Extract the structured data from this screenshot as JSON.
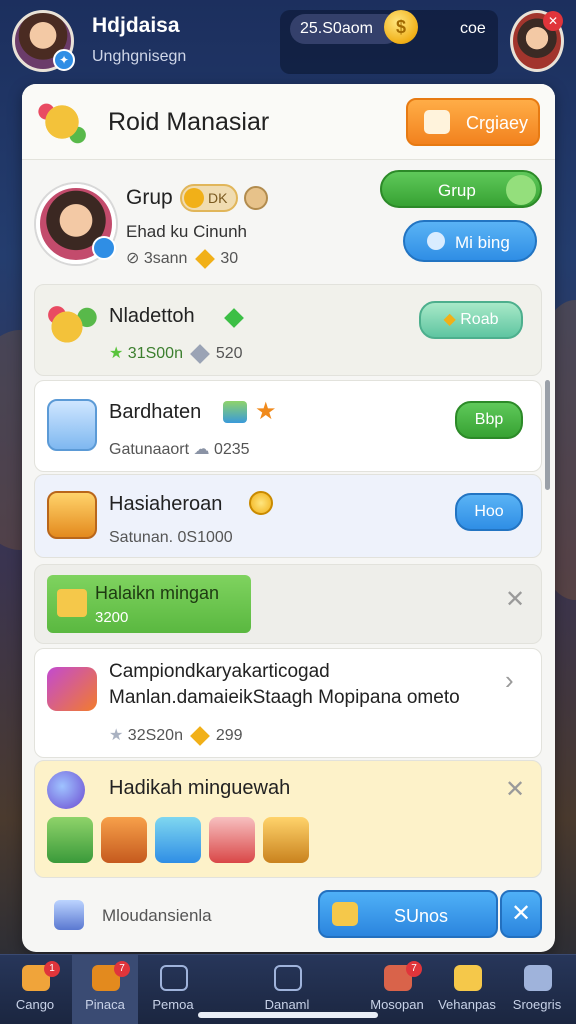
{
  "top": {
    "name": "Hdjdaisa",
    "subtitle": "Unghgnisegn",
    "coins": "25.S0aom",
    "right_text": "coe"
  },
  "panel": {
    "title": "Roid Manasiar",
    "header_button": "Crgiaey"
  },
  "profile": {
    "name": "Grup",
    "chip": "DK",
    "line1": "Ehad ku Cinunh",
    "line2_value": "3sann",
    "line2_count": "30",
    "button_green": "Grup",
    "button_blue": "Mi bing"
  },
  "cards": [
    {
      "title": "Nladettoh",
      "sub_value": "31S00n",
      "sub_count": "520",
      "button": "Roab"
    },
    {
      "title": "Bardhaten",
      "sub_label": "Gatunaaort",
      "sub_count": "0235",
      "button": "Bbp"
    },
    {
      "title": "Hasiaheroan",
      "sub_label": "Satunan. 0S1000",
      "button": "Hoo"
    },
    {
      "title": "Halaikn mingan",
      "sub_value": "3200"
    },
    {
      "title": "Campiondkaryakarticogad",
      "line2": "Manlan.damaieikStaagh Mopipana ometo",
      "sub_value": "32S20n",
      "sub_count": "299"
    },
    {
      "title": "Hadikah minguewah"
    }
  ],
  "bottom": {
    "label": "Mloudansienla",
    "button": "SUnos"
  },
  "tabs": [
    {
      "label": "Cango",
      "badge": "1"
    },
    {
      "label": "Pinaca",
      "badge": "7"
    },
    {
      "label": "Pemoa"
    },
    {
      "label": "Danaml"
    },
    {
      "label": "Mosopan",
      "badge": "7"
    },
    {
      "label": "Vehanpas"
    },
    {
      "label": "Sroegris"
    }
  ],
  "colors": {
    "accent_orange": "#f2821e",
    "accent_green": "#37a233",
    "accent_blue": "#2f8ee5",
    "badge_red": "#e0353b"
  }
}
